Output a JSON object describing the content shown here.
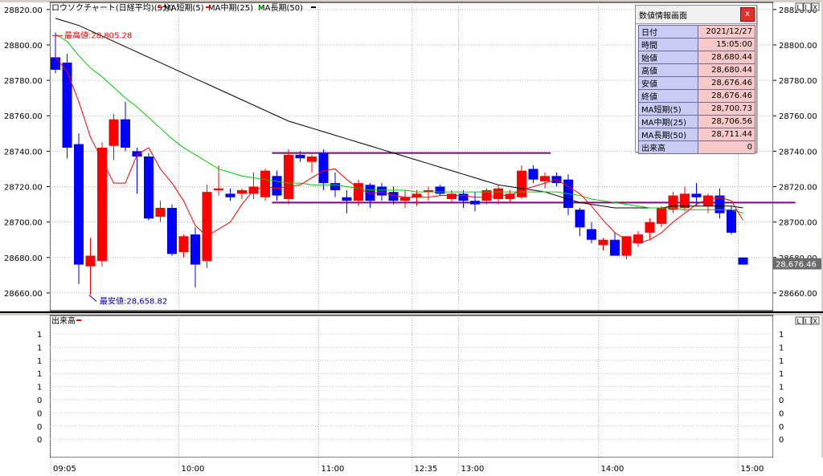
{
  "chart_title": "ロウソクチャート(日経平均)(5分)",
  "legend": {
    "ma_short": "MA短期(5)",
    "ma_mid": "MA中期(25)",
    "ma_long": "MA長期(50)"
  },
  "colors": {
    "up": "#ff0000",
    "down": "#0000ff",
    "ma_short": "#ff0000",
    "ma_mid": "#00cc00",
    "ma_long": "#000000",
    "hline": "#800080"
  },
  "price_ticks": [
    "28820.00",
    "28800.00",
    "28780.00",
    "28760.00",
    "28740.00",
    "28720.00",
    "28700.00",
    "28680.00",
    "28660.00"
  ],
  "current_price_label": "28,676.46",
  "annotations": {
    "high": "最高値:28,805.28",
    "low": "最安値:28,658.82"
  },
  "volume_panel": {
    "title": "出来高",
    "ticks": [
      "1",
      "1",
      "1",
      "1",
      "1",
      "0",
      "0",
      "0",
      "0"
    ]
  },
  "time_labels": [
    "09:05",
    "10:00",
    "11:00",
    "12:35",
    "13:00",
    "14:00",
    "15:00"
  ],
  "window_controls": [
    "L",
    "I",
    "X"
  ],
  "info_panel": {
    "title": "数値情報画面",
    "close": "x",
    "rows": [
      {
        "label": "日付",
        "value": "2021/12/27"
      },
      {
        "label": "時間",
        "value": "15:05:00"
      },
      {
        "label": "始値",
        "value": "28,680.44"
      },
      {
        "label": "高値",
        "value": "28,680.44"
      },
      {
        "label": "安値",
        "value": "28,676.46"
      },
      {
        "label": "終値",
        "value": "28,676.46"
      },
      {
        "label": "MA短期(5)",
        "value": "28,700.73"
      },
      {
        "label": "MA中期(25)",
        "value": "28,706.56"
      },
      {
        "label": "MA長期(50)",
        "value": "28,711.44"
      },
      {
        "label": "出来高",
        "value": "0"
      }
    ]
  },
  "chart_data": {
    "type": "candlestick",
    "ylim": [
      28650,
      28824
    ],
    "candles": [
      {
        "o": 28793,
        "h": 28807,
        "l": 28784,
        "c": 28786
      },
      {
        "o": 28790,
        "h": 28795,
        "l": 28736,
        "c": 28742
      },
      {
        "o": 28744,
        "h": 28750,
        "l": 28665,
        "c": 28676
      },
      {
        "o": 28675,
        "h": 28691,
        "l": 28659,
        "c": 28681
      },
      {
        "o": 28678,
        "h": 28745,
        "l": 28675,
        "c": 28742
      },
      {
        "o": 28743,
        "h": 28761,
        "l": 28735,
        "c": 28758
      },
      {
        "o": 28758,
        "h": 28768,
        "l": 28740,
        "c": 28742
      },
      {
        "o": 28740,
        "h": 28742,
        "l": 28716,
        "c": 28737
      },
      {
        "o": 28737,
        "h": 28739,
        "l": 28701,
        "c": 28702
      },
      {
        "o": 28703,
        "h": 28712,
        "l": 28700,
        "c": 28708
      },
      {
        "o": 28708,
        "h": 28710,
        "l": 28681,
        "c": 28682
      },
      {
        "o": 28683,
        "h": 28693,
        "l": 28680,
        "c": 28692
      },
      {
        "o": 28693,
        "h": 28697,
        "l": 28663,
        "c": 28676
      },
      {
        "o": 28678,
        "h": 28721,
        "l": 28674,
        "c": 28717
      },
      {
        "o": 28718,
        "h": 28732,
        "l": 28715,
        "c": 28719
      },
      {
        "o": 28716,
        "h": 28719,
        "l": 28712,
        "c": 28714
      },
      {
        "o": 28716,
        "h": 28719,
        "l": 28713,
        "c": 28718
      },
      {
        "o": 28716,
        "h": 28728,
        "l": 28713,
        "c": 28720
      },
      {
        "o": 28714,
        "h": 28730,
        "l": 28712,
        "c": 28729
      },
      {
        "o": 28726,
        "h": 28729,
        "l": 28712,
        "c": 28715
      },
      {
        "o": 28713,
        "h": 28741,
        "l": 28710,
        "c": 28738
      },
      {
        "o": 28738,
        "h": 28740,
        "l": 28734,
        "c": 28736
      },
      {
        "o": 28734,
        "h": 28738,
        "l": 28728,
        "c": 28737
      },
      {
        "o": 28739,
        "h": 28741,
        "l": 28718,
        "c": 28722
      },
      {
        "o": 28722,
        "h": 28728,
        "l": 28714,
        "c": 28718
      },
      {
        "o": 28714,
        "h": 28718,
        "l": 28705,
        "c": 28712
      },
      {
        "o": 28712,
        "h": 28724,
        "l": 28709,
        "c": 28722
      },
      {
        "o": 28721,
        "h": 28722,
        "l": 28708,
        "c": 28712
      },
      {
        "o": 28720,
        "h": 28722,
        "l": 28712,
        "c": 28715
      },
      {
        "o": 28717,
        "h": 28720,
        "l": 28710,
        "c": 28712
      },
      {
        "o": 28712,
        "h": 28718,
        "l": 28708,
        "c": 28714
      },
      {
        "o": 28714,
        "h": 28718,
        "l": 28709,
        "c": 28716
      },
      {
        "o": 28717,
        "h": 28720,
        "l": 28712,
        "c": 28718
      },
      {
        "o": 28720,
        "h": 28721,
        "l": 28715,
        "c": 28716
      },
      {
        "o": 28713,
        "h": 28718,
        "l": 28711,
        "c": 28716
      },
      {
        "o": 28716,
        "h": 28718,
        "l": 28708,
        "c": 28712
      },
      {
        "o": 28712,
        "h": 28717,
        "l": 28706,
        "c": 28710
      },
      {
        "o": 28712,
        "h": 28719,
        "l": 28710,
        "c": 28718
      },
      {
        "o": 28713,
        "h": 28721,
        "l": 28710,
        "c": 28719
      },
      {
        "o": 28713,
        "h": 28718,
        "l": 28711,
        "c": 28716
      },
      {
        "o": 28714,
        "h": 28732,
        "l": 28713,
        "c": 28729
      },
      {
        "o": 28730,
        "h": 28732,
        "l": 28722,
        "c": 28724
      },
      {
        "o": 28723,
        "h": 28728,
        "l": 28719,
        "c": 28726
      },
      {
        "o": 28726,
        "h": 28728,
        "l": 28720,
        "c": 28722
      },
      {
        "o": 28724,
        "h": 28727,
        "l": 28704,
        "c": 28708
      },
      {
        "o": 28707,
        "h": 28708,
        "l": 28692,
        "c": 28697
      },
      {
        "o": 28696,
        "h": 28700,
        "l": 28688,
        "c": 28690
      },
      {
        "o": 28687,
        "h": 28691,
        "l": 28684,
        "c": 28690
      },
      {
        "o": 28690,
        "h": 28694,
        "l": 28681,
        "c": 28681
      },
      {
        "o": 28681,
        "h": 28692,
        "l": 28679,
        "c": 28692
      },
      {
        "o": 28688,
        "h": 28695,
        "l": 28686,
        "c": 28693
      },
      {
        "o": 28694,
        "h": 28702,
        "l": 28690,
        "c": 28700
      },
      {
        "o": 28699,
        "h": 28709,
        "l": 28697,
        "c": 28708
      },
      {
        "o": 28707,
        "h": 28717,
        "l": 28705,
        "c": 28715
      },
      {
        "o": 28708,
        "h": 28720,
        "l": 28706,
        "c": 28716
      },
      {
        "o": 28716,
        "h": 28722,
        "l": 28709,
        "c": 28714
      },
      {
        "o": 28709,
        "h": 28716,
        "l": 28705,
        "c": 28715
      },
      {
        "o": 28715,
        "h": 28719,
        "l": 28702,
        "c": 28705
      },
      {
        "o": 28707,
        "h": 28709,
        "l": 28693,
        "c": 28694
      },
      {
        "o": 28680,
        "h": 28680,
        "l": 28676,
        "c": 28676
      }
    ],
    "ma_short": [
      28793,
      28785,
      28768,
      28748,
      28735,
      28722,
      28722,
      28738,
      28742,
      28730,
      28722,
      28712,
      28698,
      28692,
      28696,
      28700,
      28710,
      28718,
      28720,
      28719,
      28720,
      28721,
      28725,
      28729,
      28730,
      28724,
      28719,
      28716,
      28717,
      28715,
      28714,
      28714,
      28714,
      28715,
      28715,
      28715,
      28714,
      28714,
      28715,
      28715,
      28718,
      28720,
      28722,
      28724,
      28720,
      28716,
      28709,
      28701,
      28694,
      28690,
      28688,
      28690,
      28694,
      28700,
      28705,
      28710,
      28713,
      28714,
      28712,
      28701
    ],
    "ma_mid": [
      28806,
      28802,
      28794,
      28787,
      28782,
      28776,
      28770,
      28765,
      28759,
      28753,
      28747,
      28742,
      28738,
      28734,
      28730,
      28728,
      28726,
      28725,
      28724,
      28723,
      28722,
      28722,
      28721,
      28721,
      28721,
      28720,
      28719,
      28718,
      28718,
      28718,
      28718,
      28717,
      28717,
      28717,
      28717,
      28717,
      28717,
      28717,
      28717,
      28717,
      28717,
      28717,
      28717,
      28717,
      28716,
      28715,
      28713,
      28712,
      28711,
      28710,
      28709,
      28708,
      28708,
      28708,
      28707,
      28707,
      28707,
      28707,
      28707,
      28705
    ],
    "ma_long": [
      28815,
      28813,
      28811,
      28808,
      28805,
      28802,
      28799,
      28796,
      28793,
      28790,
      28787,
      28784,
      28781,
      28778,
      28775,
      28772,
      28769,
      28766,
      28763,
      28760,
      28757,
      28755,
      28753,
      28751,
      28749,
      28747,
      28745,
      28743,
      28741,
      28739,
      28737,
      28735,
      28733,
      28731,
      28729,
      28727,
      28725,
      28723,
      28721,
      28720,
      28719,
      28718,
      28717,
      28715,
      28713,
      28711,
      28710,
      28709,
      28708,
      28708,
      28708,
      28708,
      28708,
      28709,
      28709,
      28709,
      28709,
      28709,
      28709,
      28708
    ],
    "hlines": [
      {
        "y": 28739,
        "from": 19,
        "to": 42
      },
      {
        "y": 28711,
        "from": 19,
        "to": 63
      }
    ],
    "volume": []
  }
}
